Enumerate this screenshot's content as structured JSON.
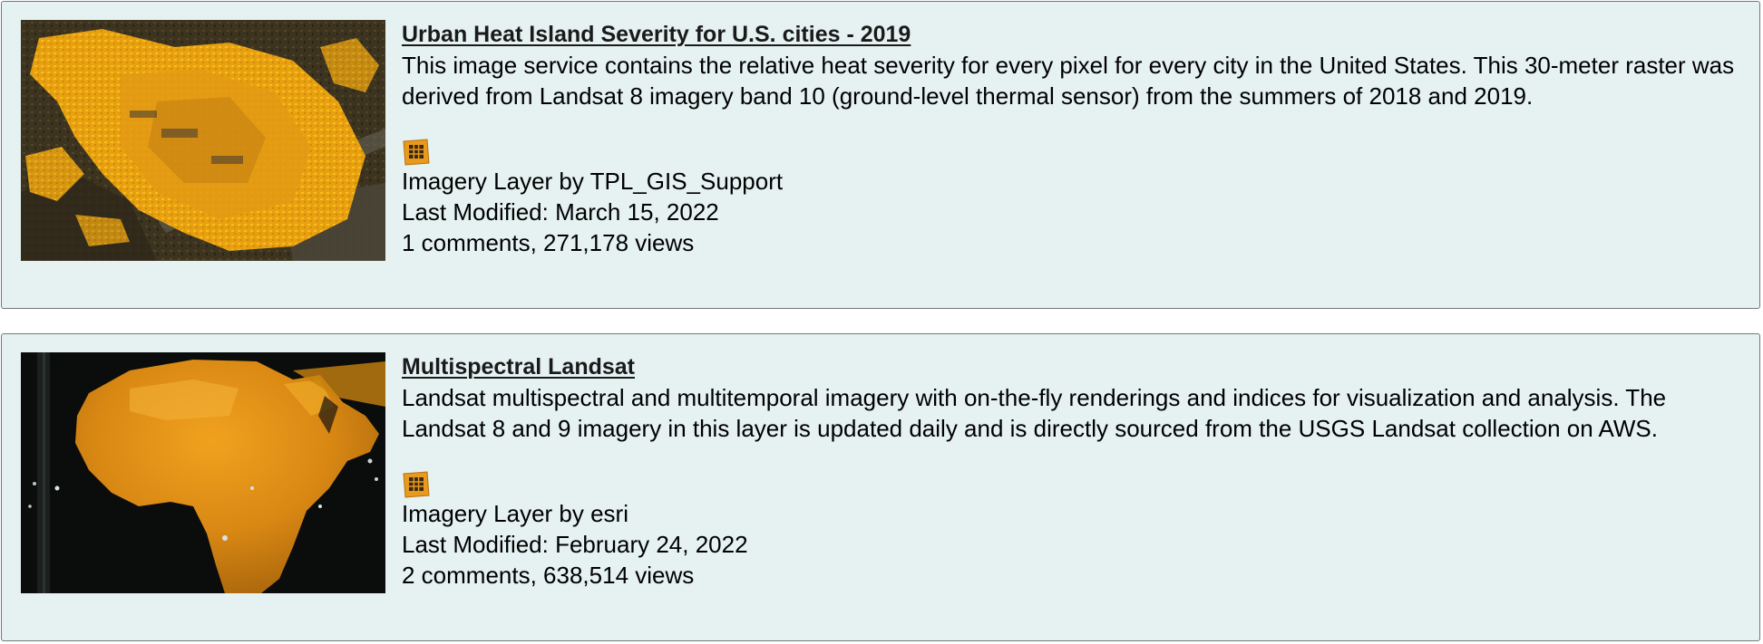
{
  "items": [
    {
      "title": "Urban Heat Island Severity for U.S. cities - 2019",
      "description": "This image service contains the relative heat severity for every pixel for every city in the United States. This 30-meter raster was derived from Landsat 8 imagery band 10 (ground-level thermal sensor) from the summers of 2018 and 2019.",
      "type_icon": "imagery-layer-icon",
      "type_line": "Imagery Layer by TPL_GIS_Support",
      "modified": "Last Modified: March 15, 2022",
      "stats": "1 comments, 271,178 views",
      "thumbnail": "heat-island-thumbnail"
    },
    {
      "title": "Multispectral Landsat",
      "description": "Landsat multispectral and multitemporal imagery with on-the-fly renderings and indices for visualization and analysis. The Landsat 8 and 9 imagery in this layer is updated daily and is directly sourced from the USGS Landsat collection on AWS.",
      "type_icon": "imagery-layer-icon",
      "type_line": "Imagery Layer by esri",
      "modified": "Last Modified: February 24, 2022",
      "stats": "2 comments, 638,514 views",
      "thumbnail": "africa-landsat-thumbnail"
    }
  ],
  "colors": {
    "card_background": "#e5f2f1",
    "card_border": "#6f7a7c",
    "icon_orange": "#e89a1c",
    "heat_yellow": "#f2b70f"
  }
}
